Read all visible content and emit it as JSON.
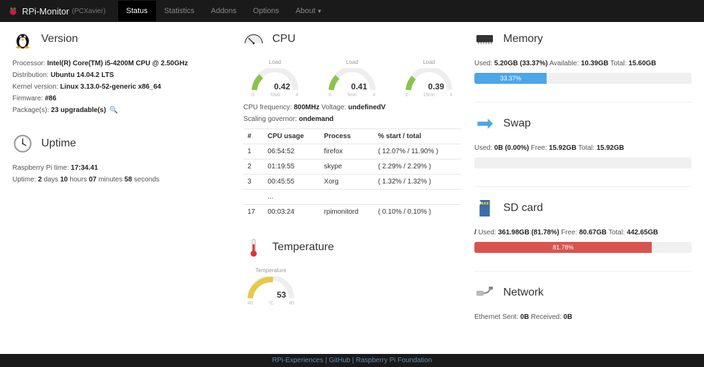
{
  "nav": {
    "brand": "RPi-Monitor",
    "sub": "(PCXavier)",
    "items": [
      "Status",
      "Statistics",
      "Addons",
      "Options",
      "About"
    ]
  },
  "version": {
    "title": "Version",
    "processor_label": "Processor:",
    "processor": "Intel(R) Core(TM) i5-4200M CPU @ 2.50GHz",
    "dist_label": "Distribution:",
    "dist": "Ubuntu 14.04.2 LTS",
    "kernel_label": "Kernel version:",
    "kernel": "Linux 3.13.0-52-generic x86_64",
    "fw_label": "Firmware:",
    "fw": "#86",
    "pkg_label": "Package(s):",
    "pkg": "23 upgradable(s)"
  },
  "uptime": {
    "title": "Uptime",
    "time_label": "Raspberry Pi time:",
    "time": "17:34.41",
    "up_label": "Uptime:",
    "up_d": "2",
    "up_h": "10",
    "up_m": "07",
    "up_s": "58",
    "days": "days",
    "hours": "hours",
    "minutes": "minutes",
    "seconds": "seconds"
  },
  "cpu": {
    "title": "CPU",
    "gauges": [
      {
        "label": "Load",
        "value": "0.42"
      },
      {
        "label": "Load",
        "value": "0.41"
      },
      {
        "label": "Load",
        "value": "0.39"
      }
    ],
    "freq_label": "CPU frequency:",
    "freq": "800MHz",
    "volt_label": "Voltage:",
    "volt": "undefinedV",
    "gov_label": "Scaling governor:",
    "gov": "ondemand",
    "th": {
      "n": "#",
      "usage": "CPU usage",
      "proc": "Process",
      "start": "% start / total"
    },
    "rows": [
      {
        "n": "1",
        "usage": "06:54:52",
        "proc": "firefox",
        "start": "( 12.07% / 11.90% )"
      },
      {
        "n": "2",
        "usage": "01:19:55",
        "proc": "skype",
        "start": "( 2.29% / 2.29% )"
      },
      {
        "n": "3",
        "usage": "00:45:55",
        "proc": "Xorg",
        "start": "( 1.32% / 1.32% )"
      },
      {
        "n": "",
        "usage": "...",
        "proc": "",
        "start": ""
      },
      {
        "n": "17",
        "usage": "00:03:24",
        "proc": "rpimonitord",
        "start": "( 0.10% / 0.10% )"
      }
    ]
  },
  "temp": {
    "title": "Temperature",
    "label": "Temperature",
    "value": "53"
  },
  "memory": {
    "title": "Memory",
    "used_label": "Used:",
    "used": "5.20GB (33.37%)",
    "avail_label": "Available:",
    "avail": "10.39GB",
    "total_label": "Total:",
    "total": "15.60GB",
    "bar": "33.37%",
    "bar_width": "33.37%"
  },
  "swap": {
    "title": "Swap",
    "used_label": "Used:",
    "used": "0B (0.00%)",
    "free_label": "Free:",
    "free": "15.92GB",
    "total_label": "Total:",
    "total": "15.92GB"
  },
  "sd": {
    "title": "SD card",
    "mount": "/",
    "used_label": "Used:",
    "used": "361.98GB (81.78%)",
    "free_label": "Free:",
    "free": "80.67GB",
    "total_label": "Total:",
    "total": "442.65GB",
    "bar": "81.78%",
    "bar_width": "81.78%"
  },
  "network": {
    "title": "Network",
    "eth_label": "Ethernet Sent:",
    "sent": "0B",
    "recv_label": "Received:",
    "recv": "0B"
  },
  "footer": {
    "a": "RPi-Experiences",
    "b": "GitHub",
    "c": "Raspberry Pi Foundation",
    "sep": " | "
  }
}
